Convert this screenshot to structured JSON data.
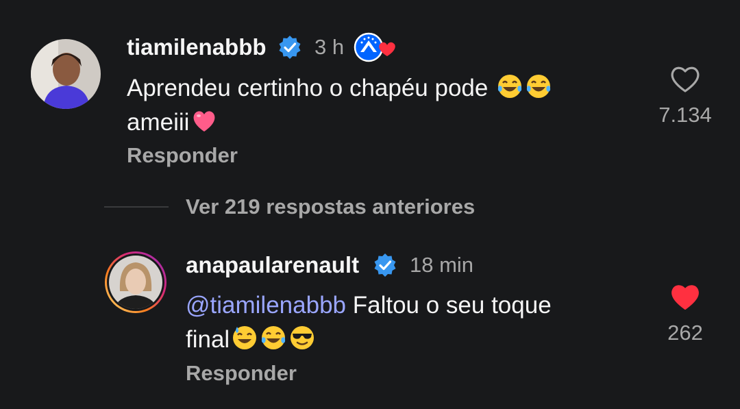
{
  "comments": [
    {
      "username": "tiamilenabbb",
      "time": "3 h",
      "text_line1": "Aprendeu certinho o chapéu pode",
      "text_line2": "ameiii",
      "reply_label": "Responder",
      "likes": "7.134",
      "liked": false
    },
    {
      "username": "anapaularenault",
      "time": "18 min",
      "mention": "@tiamilenabbb",
      "text_line1": " Faltou o seu toque",
      "text_line2": "final",
      "reply_label": "Responder",
      "likes": "262",
      "liked": true
    }
  ],
  "view_replies_label": "Ver 219 respostas anteriores",
  "colors": {
    "background": "#18191b",
    "verified": "#3897f0",
    "liked_heart": "#ff3040",
    "mention": "#9aa6ff",
    "secondary_text": "#a8a8a8"
  },
  "icons": [
    "verified-icon",
    "paramount-badge-icon",
    "heart-outline-icon",
    "heart-filled-icon",
    "tears-of-joy-emoji",
    "heart-emoji",
    "sweat-smile-emoji",
    "sunglasses-emoji"
  ]
}
